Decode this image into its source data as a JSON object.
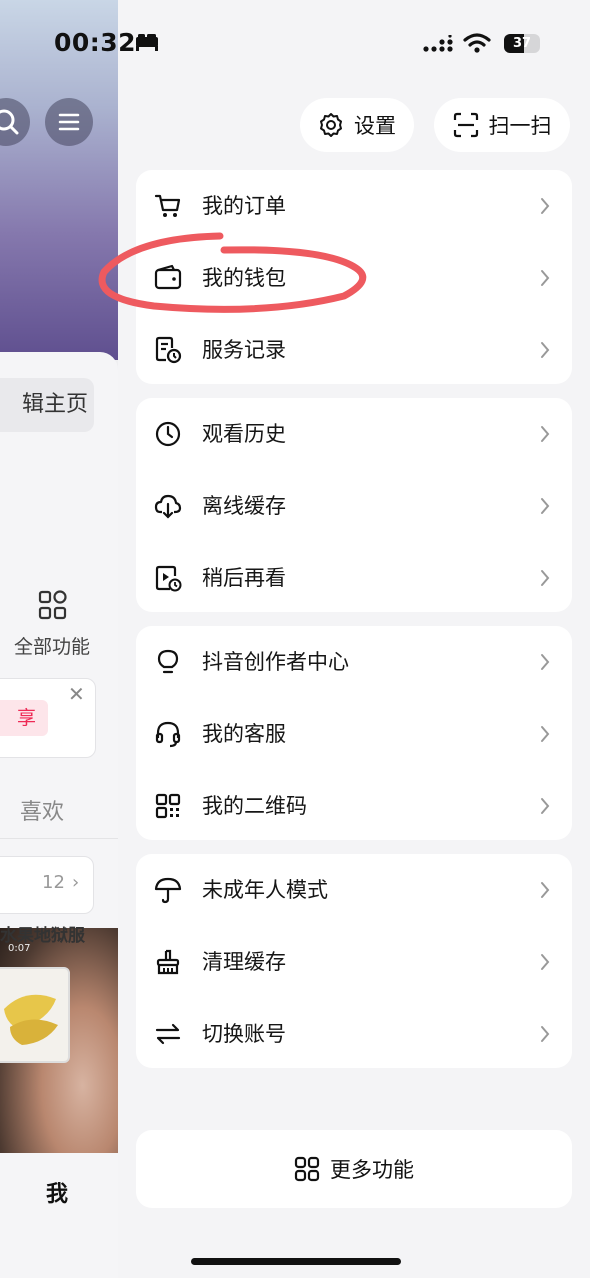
{
  "status_bar": {
    "time": "00:32",
    "battery": "37"
  },
  "background_page": {
    "edit_home": "辑主页",
    "all_functions": "全部功能",
    "promo_tag": "享",
    "close": "✕",
    "likes": "喜欢",
    "count": "12",
    "count_chevron": "›",
    "video_title": "水果地狱服",
    "video_time": "0:07",
    "me_tab": "我"
  },
  "header": {
    "settings_label": "设置",
    "scan_label": "扫一扫"
  },
  "menu": {
    "groups": [
      {
        "items": [
          {
            "label": "我的订单",
            "icon": "cart-icon"
          },
          {
            "label": "我的钱包",
            "icon": "wallet-icon"
          },
          {
            "label": "服务记录",
            "icon": "service-record-icon"
          }
        ]
      },
      {
        "items": [
          {
            "label": "观看历史",
            "icon": "clock-icon"
          },
          {
            "label": "离线缓存",
            "icon": "cloud-download-icon"
          },
          {
            "label": "稍后再看",
            "icon": "watch-later-icon"
          }
        ]
      },
      {
        "items": [
          {
            "label": "抖音创作者中心",
            "icon": "lightbulb-icon"
          },
          {
            "label": "我的客服",
            "icon": "headset-icon"
          },
          {
            "label": "我的二维码",
            "icon": "qrcode-icon"
          }
        ]
      },
      {
        "items": [
          {
            "label": "未成年人模式",
            "icon": "umbrella-icon"
          },
          {
            "label": "清理缓存",
            "icon": "broom-icon"
          },
          {
            "label": "切换账号",
            "icon": "switch-icon"
          }
        ]
      }
    ],
    "more_label": "更多功能"
  },
  "colors": {
    "annotation": "#ee5a5f",
    "promo_red": "#ee2a55"
  }
}
